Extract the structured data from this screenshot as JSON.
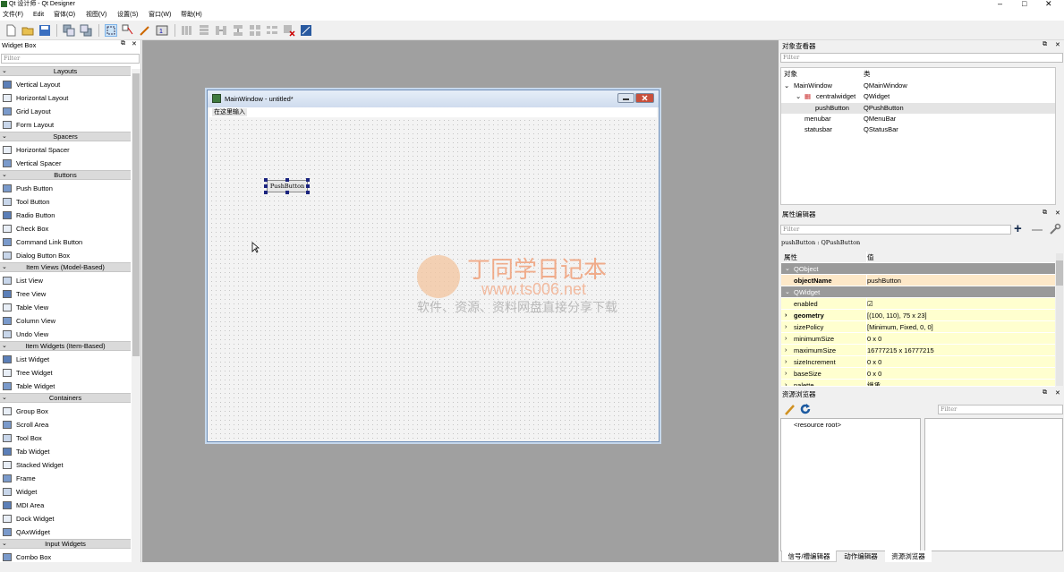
{
  "window": {
    "title": "Qt 设计师 - Qt Designer",
    "minimize": "–",
    "maximize": "□",
    "close": "✕"
  },
  "menu": [
    "文件(F)",
    "Edit",
    "窗体(O)",
    "视图(V)",
    "设置(S)",
    "窗口(W)",
    "帮助(H)"
  ],
  "widget_box": {
    "title": "Widget Box",
    "filter_placeholder": "Filter",
    "categories": [
      {
        "name": "Layouts",
        "items": [
          "Vertical Layout",
          "Horizontal Layout",
          "Grid Layout",
          "Form Layout"
        ]
      },
      {
        "name": "Spacers",
        "items": [
          "Horizontal Spacer",
          "Vertical Spacer"
        ]
      },
      {
        "name": "Buttons",
        "items": [
          "Push Button",
          "Tool Button",
          "Radio Button",
          "Check Box",
          "Command Link Button",
          "Dialog Button Box"
        ]
      },
      {
        "name": "Item Views (Model-Based)",
        "items": [
          "List View",
          "Tree View",
          "Table View",
          "Column View",
          "Undo View"
        ]
      },
      {
        "name": "Item Widgets (Item-Based)",
        "items": [
          "List Widget",
          "Tree Widget",
          "Table Widget"
        ]
      },
      {
        "name": "Containers",
        "items": [
          "Group Box",
          "Scroll Area",
          "Tool Box",
          "Tab Widget",
          "Stacked Widget",
          "Frame",
          "Widget",
          "MDI Area",
          "Dock Widget",
          "QAxWidget"
        ]
      },
      {
        "name": "Input Widgets",
        "items": [
          "Combo Box"
        ]
      }
    ]
  },
  "form": {
    "title": "MainWindow - untitled*",
    "menu_placeholder": "在这里输入",
    "push_button_label": "PushButton"
  },
  "watermark": {
    "line1": "丁同学日记本",
    "line2": "www.ts006.net",
    "line3": "软件、资源、资料网盘直接分享下载"
  },
  "object_inspector": {
    "title": "对象查看器",
    "filter_placeholder": "Filter",
    "headers": [
      "对象",
      "类"
    ],
    "rows": [
      {
        "name": "MainWindow",
        "cls": "QMainWindow"
      },
      {
        "name": "centralwidget",
        "cls": "QWidget"
      },
      {
        "name": "pushButton",
        "cls": "QPushButton"
      },
      {
        "name": "menubar",
        "cls": "QMenuBar"
      },
      {
        "name": "statusbar",
        "cls": "QStatusBar"
      }
    ]
  },
  "property_editor": {
    "title": "属性编辑器",
    "filter_placeholder": "Filter",
    "context": "pushButton : QPushButton",
    "headers": [
      "属性",
      "值"
    ],
    "rows": [
      {
        "name": "QObject",
        "value": ""
      },
      {
        "name": "objectName",
        "value": "pushButton"
      },
      {
        "name": "QWidget",
        "value": ""
      },
      {
        "name": "enabled",
        "value": "☑"
      },
      {
        "name": "geometry",
        "value": "[(100, 110), 75 x 23]"
      },
      {
        "name": "sizePolicy",
        "value": "[Minimum, Fixed, 0, 0]"
      },
      {
        "name": "minimumSize",
        "value": "0 x 0"
      },
      {
        "name": "maximumSize",
        "value": "16777215 x 16777215"
      },
      {
        "name": "sizeIncrement",
        "value": "0 x 0"
      },
      {
        "name": "baseSize",
        "value": "0 x 0"
      },
      {
        "name": "palette",
        "value": "继承"
      }
    ]
  },
  "resource_browser": {
    "title": "资源浏览器",
    "filter_placeholder": "Filter",
    "root": "<resource root>",
    "tabs": [
      "信号/槽编辑器",
      "动作编辑器",
      "资源浏览器"
    ]
  },
  "colors": {
    "mdi_bg": "#a0a0a0",
    "group_row": "#9a9a9a",
    "prop_yellow": "#ffffcf",
    "handle": "#1a237e"
  }
}
